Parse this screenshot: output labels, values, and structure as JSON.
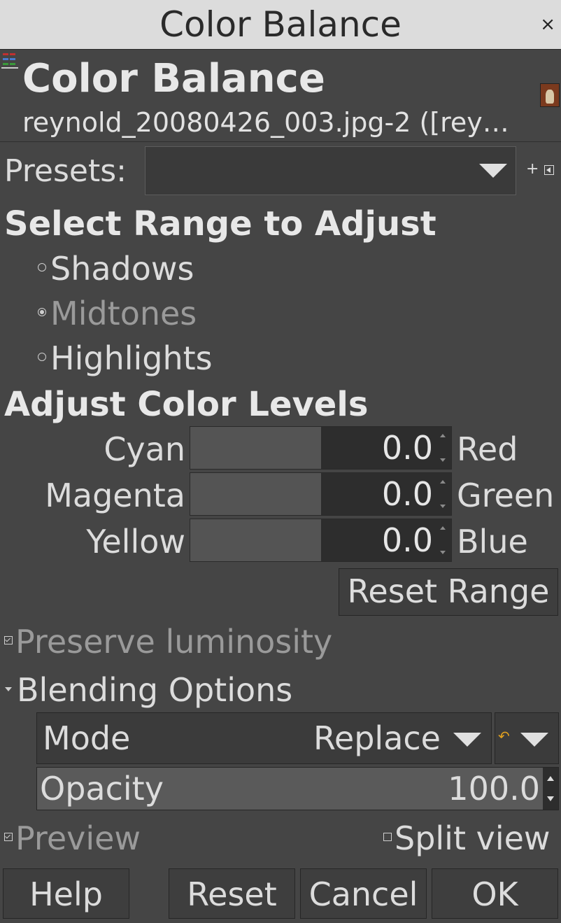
{
  "window": {
    "title": "Color Balance",
    "close_glyph": "×"
  },
  "header": {
    "title": "Color Balance",
    "subtitle": "reynold_20080426_003.jpg-2 ([rey…",
    "tool_icon": "color-balance-icon",
    "image_icon": "image-thumbnail-icon"
  },
  "presets": {
    "label": "Presets:",
    "value": "",
    "add_glyph": "+"
  },
  "range": {
    "heading": "Select Range to Adjust",
    "options": [
      {
        "label": "Shadows",
        "checked": false
      },
      {
        "label": "Midtones",
        "checked": true
      },
      {
        "label": "Highlights",
        "checked": false
      }
    ]
  },
  "levels": {
    "heading": "Adjust Color Levels",
    "sliders": [
      {
        "left": "Cyan",
        "right": "Red",
        "value": "0.0",
        "fraction": 0.5
      },
      {
        "left": "Magenta",
        "right": "Green",
        "value": "0.0",
        "fraction": 0.5
      },
      {
        "left": "Yellow",
        "right": "Blue",
        "value": "0.0",
        "fraction": 0.5
      }
    ],
    "reset_range": "Reset Range"
  },
  "preserve": {
    "label": "Preserve luminosity",
    "checked": true
  },
  "blending": {
    "heading": "Blending Options",
    "mode_label": "Mode",
    "mode_value": "Replace",
    "composite_icon": "undo-composite-icon",
    "opacity_label": "Opacity",
    "opacity_value": "100.0",
    "opacity_fraction": 1.0
  },
  "preview": {
    "label": "Preview",
    "checked": true
  },
  "split_view": {
    "label": "Split view",
    "checked": false
  },
  "buttons": {
    "help": "Help",
    "reset": "Reset",
    "cancel": "Cancel",
    "ok": "OK"
  },
  "colors": {
    "background": "#454545",
    "titlebar": "#dcdcdc",
    "disabled_text": "#9a9a9a"
  }
}
